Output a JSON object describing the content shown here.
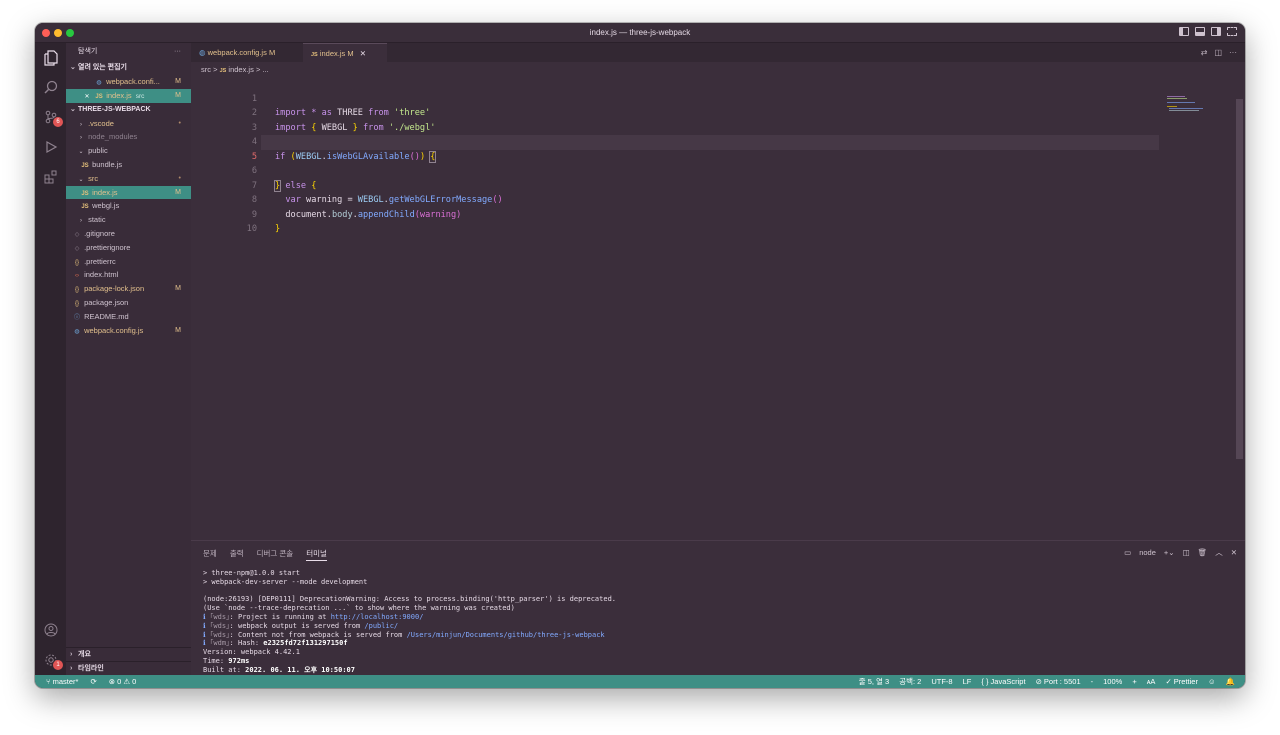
{
  "window": {
    "title": "index.js — three-js-webpack"
  },
  "activity": {
    "scm_badge": "6",
    "settings_badge": "1"
  },
  "explorer": {
    "header": "탐색기",
    "more": "···",
    "open_editors": {
      "label": "열려 있는 편집기",
      "items": [
        {
          "name": "webpack.confi...",
          "marker": "M"
        },
        {
          "name": "index.js",
          "folder": "src",
          "marker": "M"
        }
      ]
    },
    "project": {
      "label": "THREE-JS-WEBPACK",
      "items": [
        {
          "name": ".vscode",
          "marker": "•"
        },
        {
          "name": "node_modules",
          "marker": ""
        },
        {
          "name": "public",
          "marker": ""
        },
        {
          "name": "bundle.js",
          "marker": ""
        },
        {
          "name": "src",
          "marker": "•"
        },
        {
          "name": "index.js",
          "marker": "M"
        },
        {
          "name": "webgl.js",
          "marker": ""
        },
        {
          "name": "static",
          "marker": ""
        },
        {
          "name": ".gitignore",
          "marker": ""
        },
        {
          "name": ".prettierignore",
          "marker": ""
        },
        {
          "name": ".prettierrc",
          "marker": ""
        },
        {
          "name": "index.html",
          "marker": ""
        },
        {
          "name": "package-lock.json",
          "marker": "M"
        },
        {
          "name": "package.json",
          "marker": ""
        },
        {
          "name": "README.md",
          "marker": ""
        },
        {
          "name": "webpack.config.js",
          "marker": "M"
        }
      ]
    },
    "outline": "개요",
    "timeline": "타임라인"
  },
  "tabs": [
    {
      "label": "webpack.config.js",
      "marker": "M"
    },
    {
      "label": "index.js",
      "marker": "M",
      "close": "✕"
    }
  ],
  "breadcrumb": {
    "folder": "src",
    "sep": ">",
    "file": "index.js",
    "tail": "> ..."
  },
  "code": {
    "lines": [
      "1",
      "2",
      "3",
      "4",
      "5",
      "6",
      "7",
      "8",
      "9",
      "10"
    ],
    "l1": {
      "a": "import",
      "b": " * ",
      "c": "as",
      "d": " THREE ",
      "e": "from",
      "f": " 'three'"
    },
    "l2": {
      "a": "import",
      "b": " { ",
      "c": "WEBGL",
      "d": " } ",
      "e": "from",
      "f": " './webgl'"
    },
    "l4": {
      "a": "if",
      "b": " (",
      "c": "WEBGL",
      "d": ".",
      "e": "isWebGLAvailable",
      "f": "()",
      "g": ") ",
      "h": "{"
    },
    "l6": {
      "a": "}",
      "b": " else ",
      "c": "{"
    },
    "l7": {
      "a": "  var",
      "b": " warning = ",
      "c": "WEBGL",
      "d": ".",
      "e": "getWebGLErrorMessage",
      "f": "()"
    },
    "l8": {
      "a": "  document",
      "b": ".",
      "c": "body",
      "d": ".",
      "e": "appendChild",
      "f": "(warning)"
    },
    "l9": {
      "a": "}"
    }
  },
  "panel": {
    "tabs": [
      "문제",
      "출력",
      "디버그 콘솔",
      "터미널"
    ],
    "terminal_name": "node",
    "term": {
      "l1": "> three-npm@1.0.0 start",
      "l2": "> webpack-dev-server --mode development",
      "l3": "(node:26193) [DEP0111] DeprecationWarning: Access to process.binding('http_parser') is deprecated.",
      "l4": "(Use `node --trace-deprecation ...` to show where the warning was created)",
      "l5a": "｢wds｣",
      "l5b": ": Project is running at ",
      "l5c": "http://localhost:9000/",
      "l6a": "｢wds｣",
      "l6b": ": webpack output is served from ",
      "l6c": "/public/",
      "l7a": "｢wds｣",
      "l7b": ": Content not from webpack is served from ",
      "l7c": "/Users/minjun/Documents/github/three-js-webpack",
      "l8a": "｢wdm｣",
      "l8b": ": Hash: ",
      "l8c": "e2325fd72f131297150f",
      "l9": "Version: webpack 4.42.1",
      "l10a": "Time: ",
      "l10b": "972ms",
      "l11a": "Built at: ",
      "l11b": "2022. 06. 11. 오후 10:50:07"
    }
  },
  "status": {
    "branch": "master*",
    "sync": "⟳",
    "problems": "⊗ 0 ⚠ 0",
    "cursor": "줄 5, 열 3",
    "spaces": "공백: 2",
    "encoding": "UTF-8",
    "eol": "LF",
    "language": "{ } JavaScript",
    "port": "⊘ Port : 5501",
    "zoom_out": "-",
    "zoom": "100%",
    "zoom_in": "+",
    "prettier": "✓ Prettier"
  },
  "colors": {
    "accent": "#3e8f85",
    "background": "#3b2e3b",
    "modified": "#e2c08d"
  }
}
